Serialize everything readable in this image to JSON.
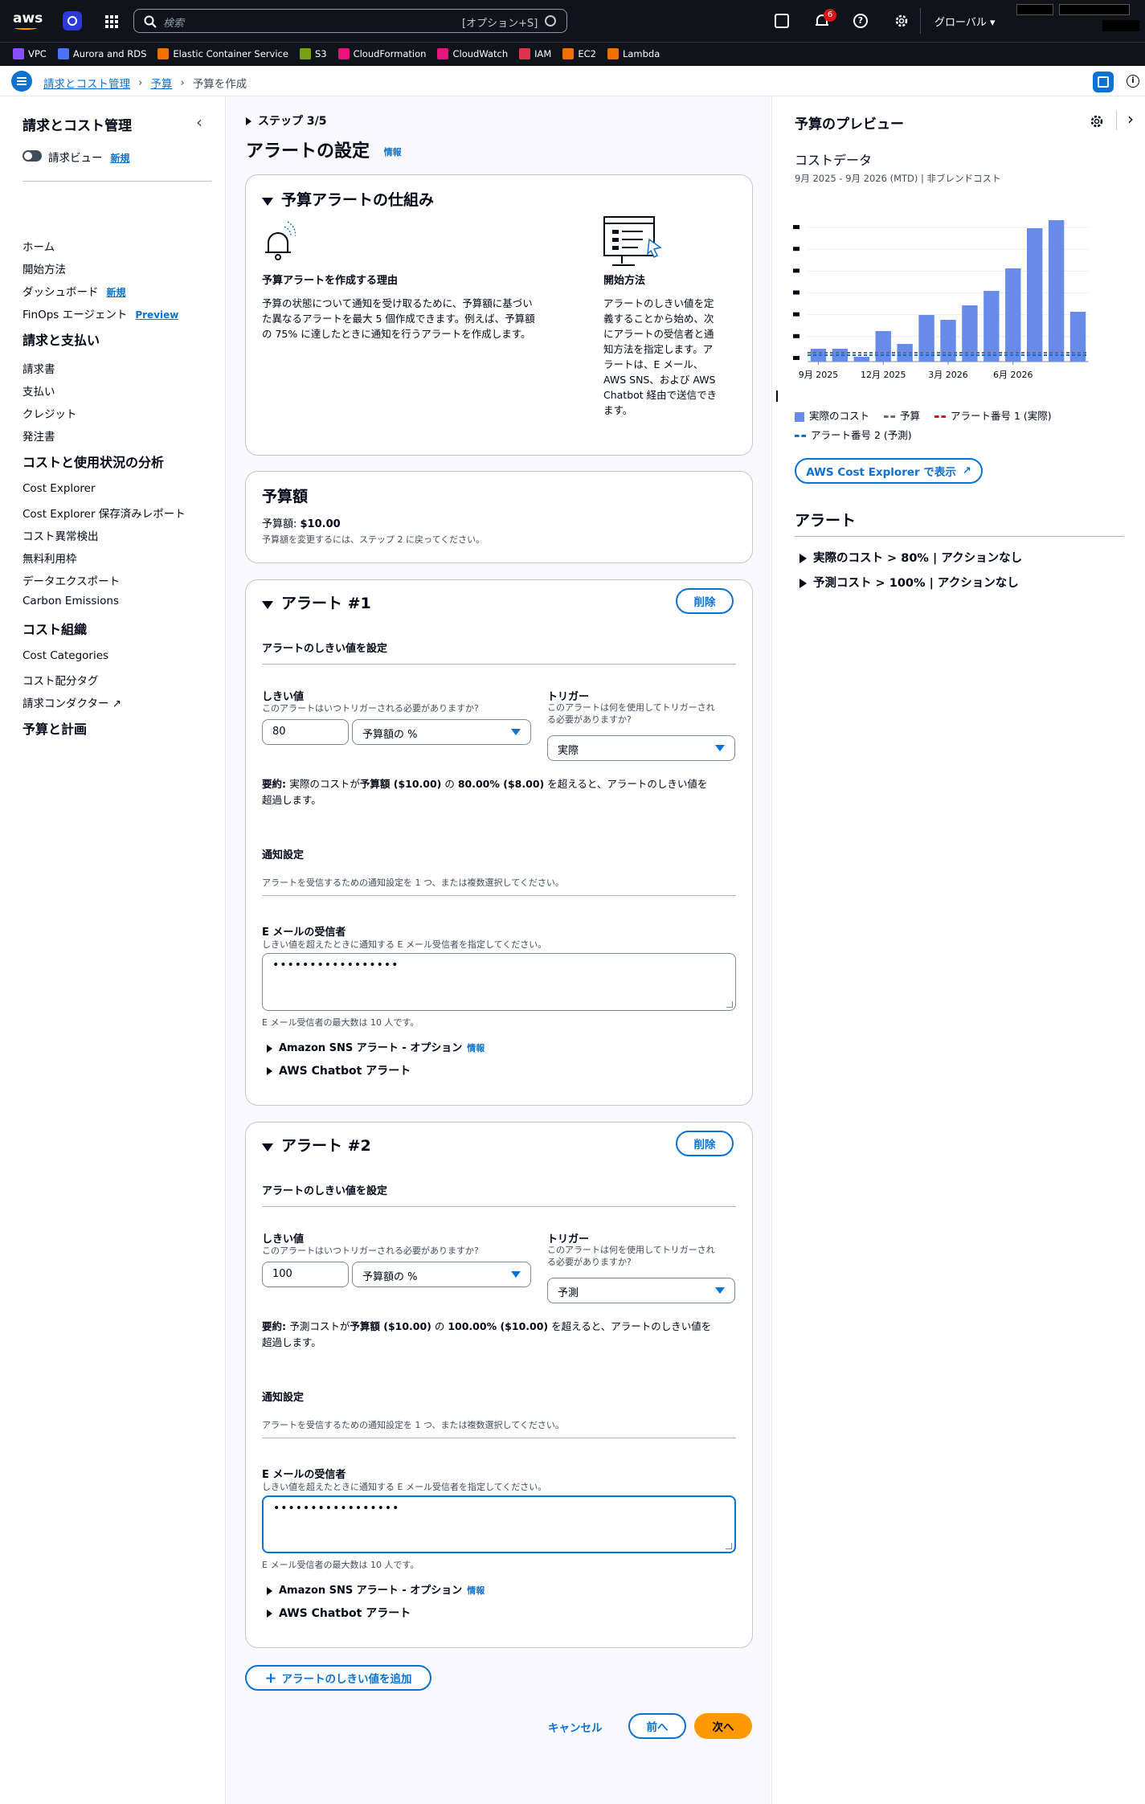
{
  "topbar": {
    "logo": "aws",
    "search_placeholder": "検索",
    "search_shortcut": "[オプション+S]",
    "notif_count": "6",
    "region": "グローバル ▾"
  },
  "services": [
    "VPC",
    "Aurora and RDS",
    "Elastic Container Service",
    "S3",
    "CloudFormation",
    "CloudWatch",
    "IAM",
    "EC2",
    "Lambda"
  ],
  "service_colors": [
    "#8c4fff",
    "#4d72f3",
    "#ed7100",
    "#7aa116",
    "#e7157b",
    "#e7157b",
    "#dd344c",
    "#ed7100",
    "#ed7100"
  ],
  "breadcrumb": {
    "item1": "請求とコスト管理",
    "item2": "予算",
    "item3": "予算を作成"
  },
  "leftnav": {
    "title": "請求とコスト管理",
    "toggle_label": "請求ビュー",
    "new": "新規",
    "preview": "Preview",
    "items1": [
      "ホーム",
      "開始方法",
      "ダッシュボード",
      "FinOps エージェント"
    ],
    "sec1": "請求と支払い",
    "items2": [
      "請求書",
      "支払い",
      "クレジット",
      "発注書"
    ],
    "sec2": "コストと使用状況の分析",
    "items3": [
      "Cost Explorer",
      "Cost Explorer 保存済みレポート",
      "コスト異常検出",
      "無料利用枠",
      "データエクスポート",
      "Carbon Emissions"
    ],
    "sec3": "コスト組織",
    "items4": [
      "Cost Categories",
      "コスト配分タグ",
      "請求コンダクター"
    ],
    "sec4": "予算と計画"
  },
  "main": {
    "step": "ステップ 3/5",
    "title": "アラートの設定",
    "info": "情報",
    "how": {
      "title": "予算アラートの仕組み",
      "col1_title": "予算アラートを作成する理由",
      "col1_text": [
        "予算の状態について通知を受け取るために、予算額に基づい",
        "た異なるアラートを最大 5 個作成できます。例えば、予算額",
        "の 75% に達したときに通知を行うアラートを作成します。"
      ],
      "col2_title": "開始方法",
      "col2_text": [
        "アラートのしきい値を定",
        "義することから始め、次",
        "にアラートの受信者と通",
        "知方法を指定します。ア",
        "ラートは、E メール、",
        "AWS SNS、および AWS",
        "Chatbot 経由で送信でき",
        "ます。"
      ]
    },
    "budget": {
      "title": "予算額",
      "amount_label": "予算額: ",
      "amount": "$10.00",
      "note": "予算額を変更するには、ステップ 2 に戻ってください。"
    },
    "alerts": [
      {
        "title": "アラート #1",
        "delete": "削除",
        "threshold_section": "アラートのしきい値を設定",
        "threshold_label": "しきい値",
        "threshold_desc": "このアラートはいつトリガーされる必要がありますか?",
        "threshold_value": "80",
        "threshold_unit": "予算額の %",
        "trigger_label": "トリガー",
        "trigger_desc1": "このアラートは何を使用してトリガーされ",
        "trigger_desc2": "る必要がありますか?",
        "trigger_value": "実際",
        "summary_bold": "要約: ",
        "summary1": "実際のコストが",
        "summary_b2": "予算額 ($10.00)",
        "summary2": " の ",
        "summary_b3": "80.00% ($8.00)",
        "summary3": " を超えると、アラートのしきい値を",
        "summary4": "超過します。",
        "notif_title": "通知設定",
        "notif_desc": "アラートを受信するための通知設定を 1 つ、または複数選択してください。",
        "email_label": "E メールの受信者",
        "email_desc": "しきい値を超えたときに通知する E メール受信者を指定してください。",
        "email_value": "•••••••••••••••••",
        "email_max": "E メール受信者の最大数は 10 人です。",
        "sns": "Amazon SNS アラート - オプション",
        "sns_info": "情報",
        "chatbot": "AWS Chatbot アラート"
      },
      {
        "title": "アラート #2",
        "delete": "削除",
        "threshold_section": "アラートのしきい値を設定",
        "threshold_label": "しきい値",
        "threshold_desc": "このアラートはいつトリガーされる必要がありますか?",
        "threshold_value": "100",
        "threshold_unit": "予算額の %",
        "trigger_label": "トリガー",
        "trigger_desc1": "このアラートは何を使用してトリガーされ",
        "trigger_desc2": "る必要がありますか?",
        "trigger_value": "予測",
        "summary_bold": "要約: ",
        "summary1": "予測コストが",
        "summary_b2": "予算額 ($10.00)",
        "summary2": " の ",
        "summary_b3": "100.00% ($10.00)",
        "summary3": " を超えると、アラートのしきい値を",
        "summary4": "超過します。",
        "notif_title": "通知設定",
        "notif_desc": "アラートを受信するための通知設定を 1 つ、または複数選択してください。",
        "email_label": "E メールの受信者",
        "email_desc": "しきい値を超えたときに通知する E メール受信者を指定してください。",
        "email_value": "•••••••••••••••••",
        "email_max": "E メール受信者の最大数は 10 人です。",
        "sns": "Amazon SNS アラート - オプション",
        "sns_info": "情報",
        "chatbot": "AWS Chatbot アラート"
      }
    ],
    "add_alert": "アラートのしきい値を追加",
    "cancel": "キャンセル",
    "prev": "前へ",
    "next": "次へ"
  },
  "right": {
    "title": "予算のプレビュー",
    "cost_data": "コストデータ",
    "range": "9月 2025 - 9月 2026 (MTD) | 非ブレンドコスト",
    "explorer_btn": "AWS Cost Explorer で表示",
    "alerts_title": "アラート",
    "alert_items": [
      "実際のコスト > 80% | アクションなし",
      "予測コスト > 100% | アクションなし"
    ],
    "legend": [
      "実際のコスト",
      "予算",
      "アラート番号 1 (実際)",
      "アラート番号 2 (予測)"
    ]
  },
  "chart_data": {
    "type": "bar",
    "x_tick_labels": [
      "9月 2025",
      "12月 2025",
      "3月 2026",
      "6月 2026"
    ],
    "values": [
      0.8,
      0.8,
      0.3,
      1.9,
      1.1,
      2.9,
      2.6,
      3.5,
      4.4,
      5.8,
      8.3,
      8.8,
      3.1
    ],
    "budget": 0.5,
    "alert1": 0.4,
    "alert2": 0.5,
    "ylim": [
      0,
      9.5
    ],
    "colors": {
      "actual": "#688ae8",
      "budget": "#5f6b7a",
      "alert1": "#d91515",
      "alert2": "#0972d3"
    }
  }
}
